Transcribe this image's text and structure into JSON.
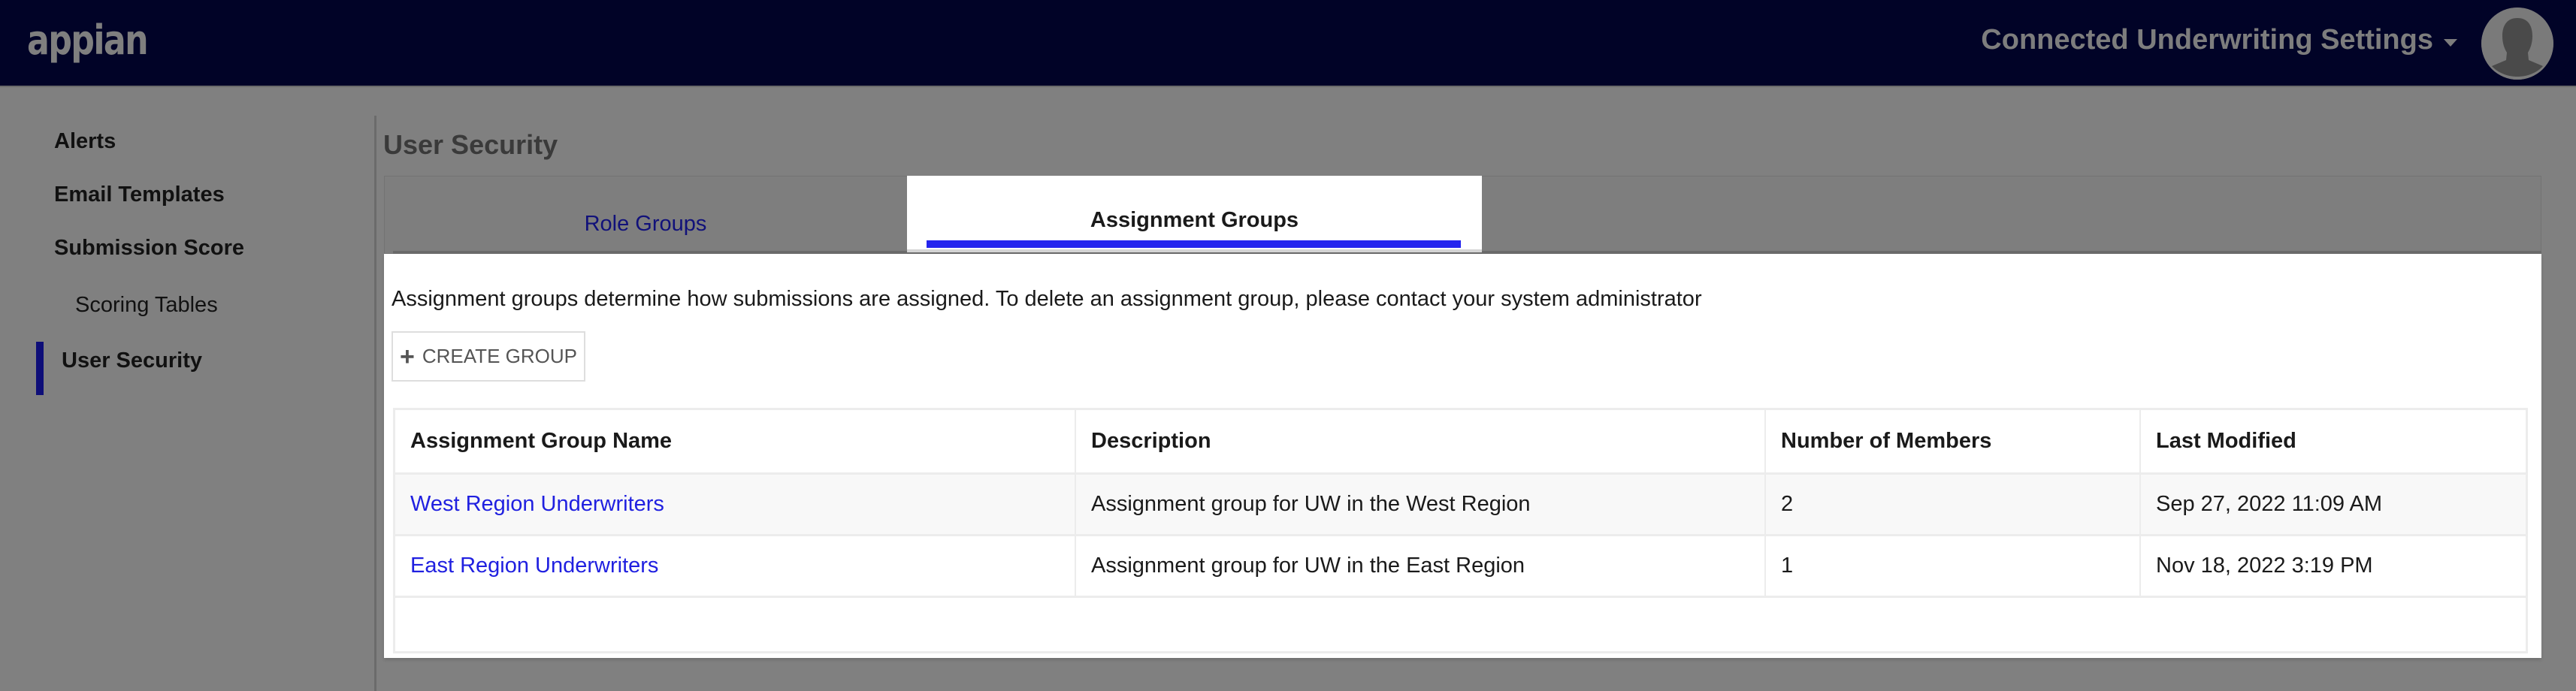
{
  "header": {
    "logo_text": "appian",
    "app_title": "Connected Underwriting Settings",
    "colors": {
      "header_bg": "#010327",
      "overlay": "#808080"
    },
    "avatar_icon": "user-silhouette-icon"
  },
  "sidebar": {
    "items": [
      {
        "label": "Alerts",
        "level": 1,
        "active": false
      },
      {
        "label": "Email Templates",
        "level": 1,
        "active": false
      },
      {
        "label": "Submission Score",
        "level": 1,
        "active": false
      },
      {
        "label": "Scoring Tables",
        "level": 2,
        "active": false
      },
      {
        "label": "User Security",
        "level": 1,
        "active": true
      }
    ],
    "active_color": "#0e0e78"
  },
  "main": {
    "page_title": "User Security",
    "tabs": [
      {
        "label": "Role Groups",
        "selected": false
      },
      {
        "label": "Assignment Groups",
        "selected": true
      }
    ],
    "tab_accent_color": "#2424ee",
    "intro_text": "Assignment groups determine how submissions are assigned. To delete an assignment group, please contact your system administrator",
    "create_button": {
      "icon": "plus-icon",
      "icon_glyph": "+",
      "label": "CREATE GROUP"
    },
    "table": {
      "columns": [
        "Assignment Group Name",
        "Description",
        "Number of Members",
        "Last Modified"
      ],
      "rows": [
        {
          "name": "West Region Underwriters",
          "description": "Assignment group for UW in the West Region",
          "members": "2",
          "last_modified": "Sep 27, 2022 11:09 AM"
        },
        {
          "name": "East Region Underwriters",
          "description": "Assignment group for UW in the East Region",
          "members": "1",
          "last_modified": "Nov 18, 2022 3:19 PM"
        }
      ],
      "link_color": "#2020e0"
    }
  }
}
